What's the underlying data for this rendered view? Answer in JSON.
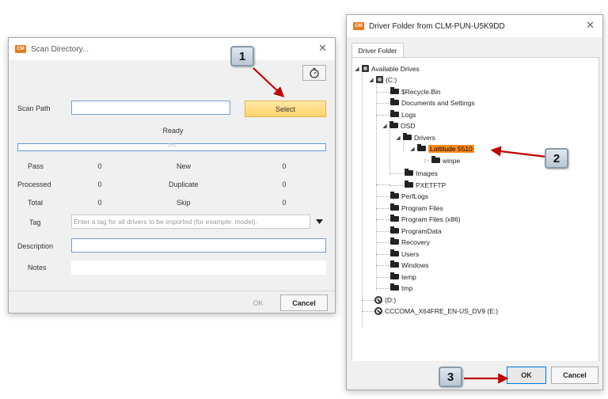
{
  "scan_dialog": {
    "logo": "CM",
    "title": "Scan Directory...",
    "close": "✕",
    "timer_icon": "stopwatch-icon",
    "scan_path_label": "Scan Path",
    "scan_path_value": "",
    "select_label": "Select",
    "status": "Ready",
    "progress_text": "0%",
    "progress_value": 0,
    "stats": {
      "pass_label": "Pass",
      "pass_value": "0",
      "new_label": "New",
      "new_value": "0",
      "processed_label": "Processed",
      "processed_value": "0",
      "duplicate_label": "Duplicate",
      "duplicate_value": "0",
      "total_label": "Total",
      "total_value": "0",
      "skip_label": "Skip",
      "skip_value": "0"
    },
    "tag_label": "Tag",
    "tag_placeholder": "Enter a tag for all drivers to be imported (for example: model).",
    "description_label": "Description",
    "notes_label": "Notes",
    "ok_label": "OK",
    "cancel_label": "Cancel"
  },
  "folder_dialog": {
    "logo": "CM",
    "title": "Driver Folder from CLM-PUN-U5K9DD",
    "close": "✕",
    "tab_label": "Driver Folder",
    "tree": {
      "root": "Available Drives",
      "c_drive": "(C:)",
      "items": {
        "recycle": "$Recycle.Bin",
        "docs": "Documents and Settings",
        "logs": "Logs",
        "osd": "OSD",
        "drivers": "Drivers",
        "latitude": "Lattitude 5510",
        "winpe": "winpe",
        "images": "Images",
        "pxeftp": "PXETFTP",
        "perflogs": "PerfLogs",
        "progfiles": "Program Files",
        "progfiles86": "Program Files (x86)",
        "progdata": "ProgramData",
        "recovery": "Recovery",
        "users": "Users",
        "windows": "Windows",
        "temp": "temp",
        "tmp": "tmp"
      },
      "d_drive": "(D:)",
      "e_drive": "CCCOMA_X64FRE_EN-US_DV9 (E:)"
    },
    "ok_label": "OK",
    "cancel_label": "Cancel"
  },
  "callouts": {
    "one": "1",
    "two": "2",
    "three": "3"
  },
  "colors": {
    "selection": "#ff8c1a",
    "arrow": "#c00000",
    "select_button": "#fcd36a",
    "logo": "#e87b1d"
  }
}
